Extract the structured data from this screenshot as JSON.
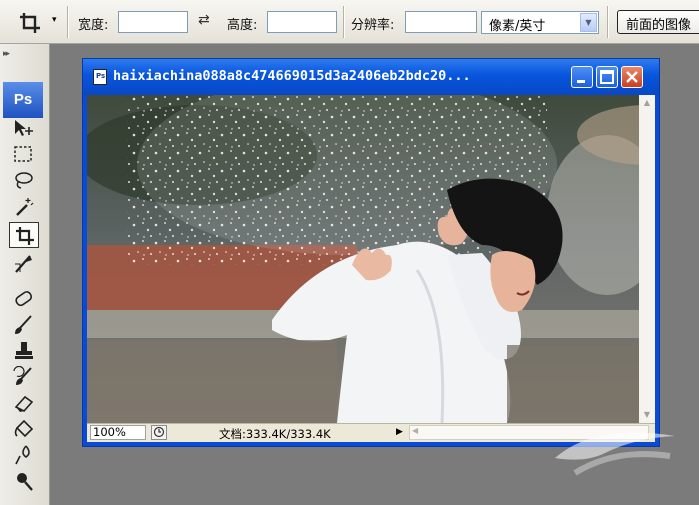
{
  "options_bar": {
    "width_label": "宽度:",
    "height_label": "高度:",
    "resolution_label": "分辨率:",
    "width_value": "",
    "height_value": "",
    "resolution_value": "",
    "units_selected": "像素/英寸",
    "front_image_button": "前面的图像"
  },
  "toolbox": {
    "logo": "Ps",
    "tools": [
      "move-icon",
      "marquee-icon",
      "lasso-icon",
      "magic-wand-icon",
      "crop-icon",
      "slice-icon",
      "healing-brush-icon",
      "brush-icon",
      "clone-stamp-icon",
      "history-brush-icon",
      "eraser-icon",
      "paint-bucket-icon",
      "blur-icon",
      "dodge-icon"
    ],
    "active_tool": "crop-icon"
  },
  "document": {
    "title": "haixiachina088a8c474669015d3a2406eb2bdc20...",
    "zoom": "100%",
    "doc_info": "文档:333.4K/333.4K"
  }
}
